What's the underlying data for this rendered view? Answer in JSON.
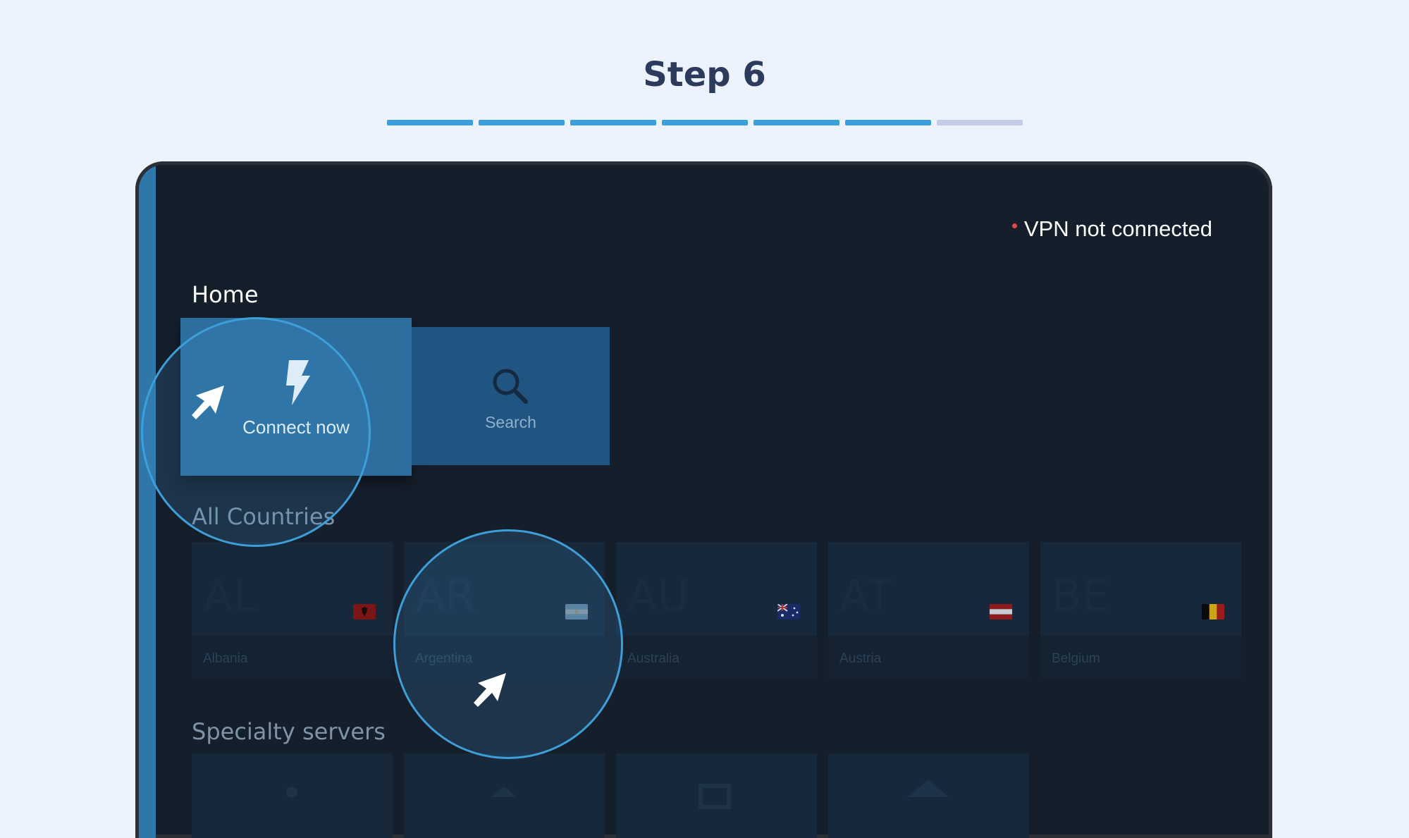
{
  "header": {
    "title": "Step 6"
  },
  "progress": {
    "total_steps": 7,
    "completed_steps": 6,
    "active_color": "#3b9fdd",
    "inactive_color": "#c3cde9"
  },
  "status": {
    "vpn_text": "VPN not connected",
    "dot_color": "#e24a4a"
  },
  "home": {
    "title": "Home",
    "connect_label": "Connect now",
    "search_label": "Search"
  },
  "countries": {
    "title": "All Countries",
    "items": [
      {
        "code": "AL",
        "name": "Albania"
      },
      {
        "code": "AR",
        "name": "Argentina"
      },
      {
        "code": "AU",
        "name": "Australia"
      },
      {
        "code": "AT",
        "name": "Austria"
      },
      {
        "code": "BE",
        "name": "Belgium"
      }
    ]
  },
  "specialty": {
    "title": "Specialty servers"
  },
  "icons": {
    "connect": "lightning-bolt-icon",
    "search": "magnifier-icon",
    "pointer": "cursor-arrow-icon"
  }
}
